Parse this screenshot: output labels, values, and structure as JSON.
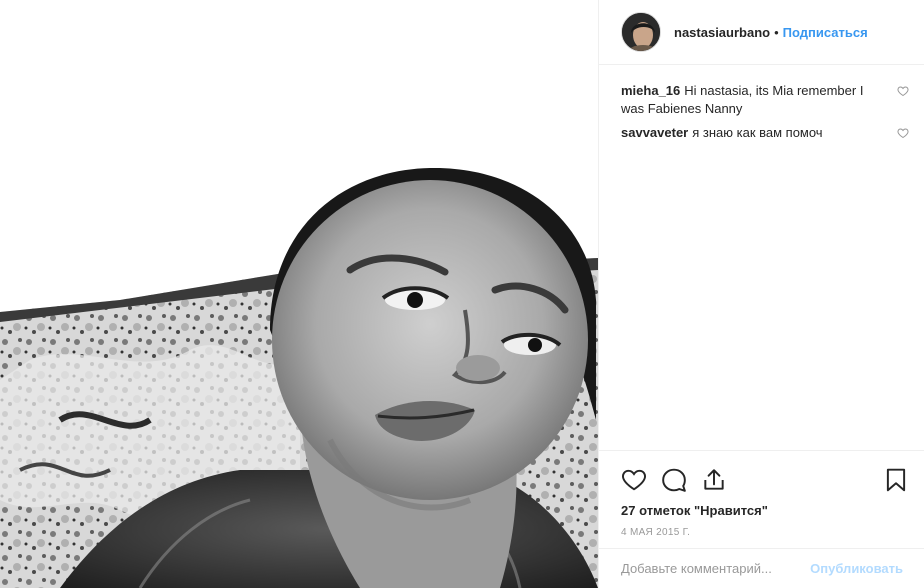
{
  "header": {
    "username": "nastasiaurbano",
    "separator": "•",
    "follow_label": "Подписаться"
  },
  "comments": [
    {
      "user": "mieha_16",
      "text": "Hi nastasia, its Mia remember I was Fabienes Nanny"
    },
    {
      "user": "savvaveter",
      "text": "я знаю как вам помоч"
    }
  ],
  "icons": {
    "like": "heart-icon",
    "comment": "comment-bubble-icon",
    "share": "share-icon",
    "save": "bookmark-icon",
    "comment_like": "small-heart-icon"
  },
  "likes_label": "27 отметок \"Нравится\"",
  "date_label": "4 МАЯ 2015 Г.",
  "add_comment": {
    "placeholder": "Добавьте комментарий...",
    "publish_label": "Опубликовать"
  },
  "colors": {
    "accent": "#3897f0",
    "text": "#262626",
    "muted": "#999999",
    "border": "#efefef"
  }
}
